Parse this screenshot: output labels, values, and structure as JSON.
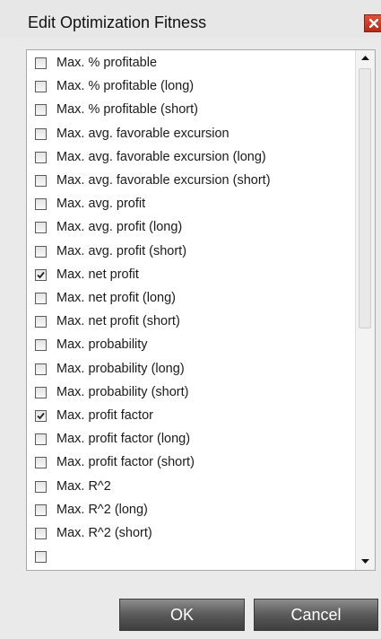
{
  "dialog": {
    "title": "Edit Optimization Fitness",
    "ok_label": "OK",
    "cancel_label": "Cancel"
  },
  "items": [
    {
      "label": "Max. % profitable",
      "checked": false
    },
    {
      "label": "Max. % profitable (long)",
      "checked": false
    },
    {
      "label": "Max. % profitable (short)",
      "checked": false
    },
    {
      "label": "Max. avg. favorable excursion",
      "checked": false
    },
    {
      "label": "Max. avg. favorable excursion (long)",
      "checked": false
    },
    {
      "label": "Max. avg. favorable excursion (short)",
      "checked": false
    },
    {
      "label": "Max. avg. profit",
      "checked": false
    },
    {
      "label": "Max. avg. profit (long)",
      "checked": false
    },
    {
      "label": "Max. avg. profit (short)",
      "checked": false
    },
    {
      "label": "Max. net profit",
      "checked": true
    },
    {
      "label": "Max. net profit (long)",
      "checked": false
    },
    {
      "label": "Max. net profit (short)",
      "checked": false
    },
    {
      "label": "Max. probability",
      "checked": false
    },
    {
      "label": "Max. probability (long)",
      "checked": false
    },
    {
      "label": "Max. probability (short)",
      "checked": false
    },
    {
      "label": "Max. profit factor",
      "checked": true
    },
    {
      "label": "Max. profit factor (long)",
      "checked": false
    },
    {
      "label": "Max. profit factor (short)",
      "checked": false
    },
    {
      "label": "Max. R^2",
      "checked": false
    },
    {
      "label": "Max. R^2 (long)",
      "checked": false
    },
    {
      "label": "Max. R^2 (short)",
      "checked": false
    }
  ],
  "icons": {
    "close": "close-icon",
    "scroll_up": "chevron-up-icon",
    "scroll_down": "chevron-down-icon",
    "check": "check-icon"
  },
  "colors": {
    "close_button": "#c9371f",
    "button_dark": "#4a4a4a"
  }
}
